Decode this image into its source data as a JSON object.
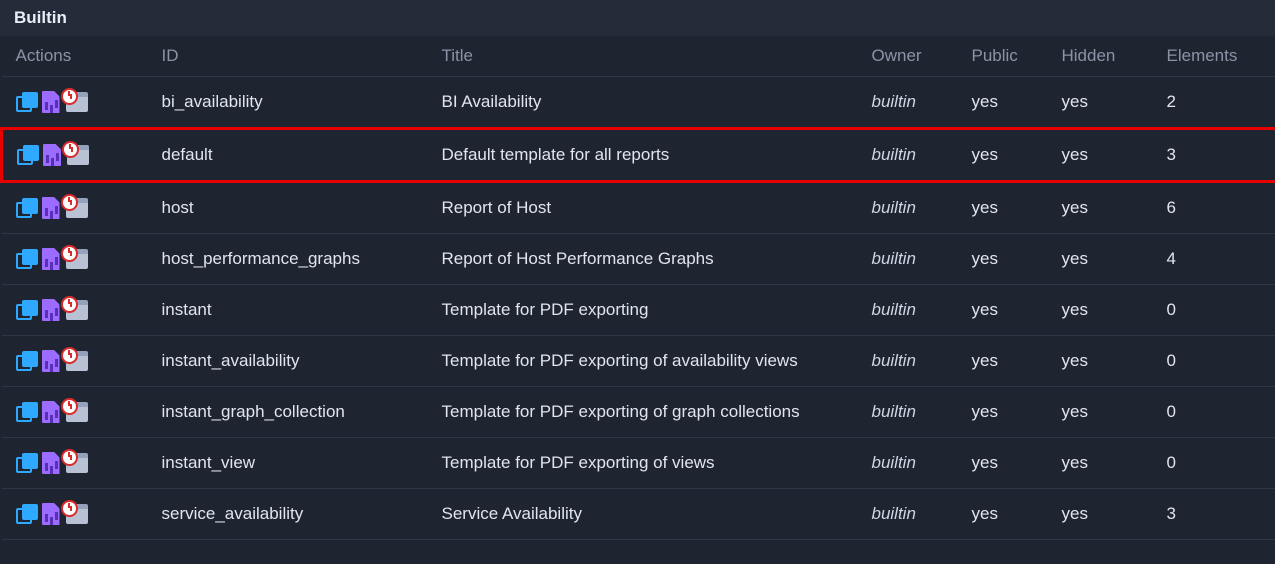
{
  "section": {
    "title": "Builtin"
  },
  "columns": {
    "actions": "Actions",
    "id": "ID",
    "title": "Title",
    "owner": "Owner",
    "public": "Public",
    "hidden": "Hidden",
    "elements": "Elements"
  },
  "highlight_id": "default",
  "rows": [
    {
      "id": "bi_availability",
      "title": "BI Availability",
      "owner": "builtin",
      "public": "yes",
      "hidden": "yes",
      "elements": "2"
    },
    {
      "id": "default",
      "title": "Default template for all reports",
      "owner": "builtin",
      "public": "yes",
      "hidden": "yes",
      "elements": "3"
    },
    {
      "id": "host",
      "title": "Report of Host",
      "owner": "builtin",
      "public": "yes",
      "hidden": "yes",
      "elements": "6"
    },
    {
      "id": "host_performance_graphs",
      "title": "Report of Host Performance Graphs",
      "owner": "builtin",
      "public": "yes",
      "hidden": "yes",
      "elements": "4"
    },
    {
      "id": "instant",
      "title": "Template for PDF exporting",
      "owner": "builtin",
      "public": "yes",
      "hidden": "yes",
      "elements": "0"
    },
    {
      "id": "instant_availability",
      "title": "Template for PDF exporting of availability views",
      "owner": "builtin",
      "public": "yes",
      "hidden": "yes",
      "elements": "0"
    },
    {
      "id": "instant_graph_collection",
      "title": "Template for PDF exporting of graph collections",
      "owner": "builtin",
      "public": "yes",
      "hidden": "yes",
      "elements": "0"
    },
    {
      "id": "instant_view",
      "title": "Template for PDF exporting of views",
      "owner": "builtin",
      "public": "yes",
      "hidden": "yes",
      "elements": "0"
    },
    {
      "id": "service_availability",
      "title": "Service Availability",
      "owner": "builtin",
      "public": "yes",
      "hidden": "yes",
      "elements": "3"
    }
  ]
}
